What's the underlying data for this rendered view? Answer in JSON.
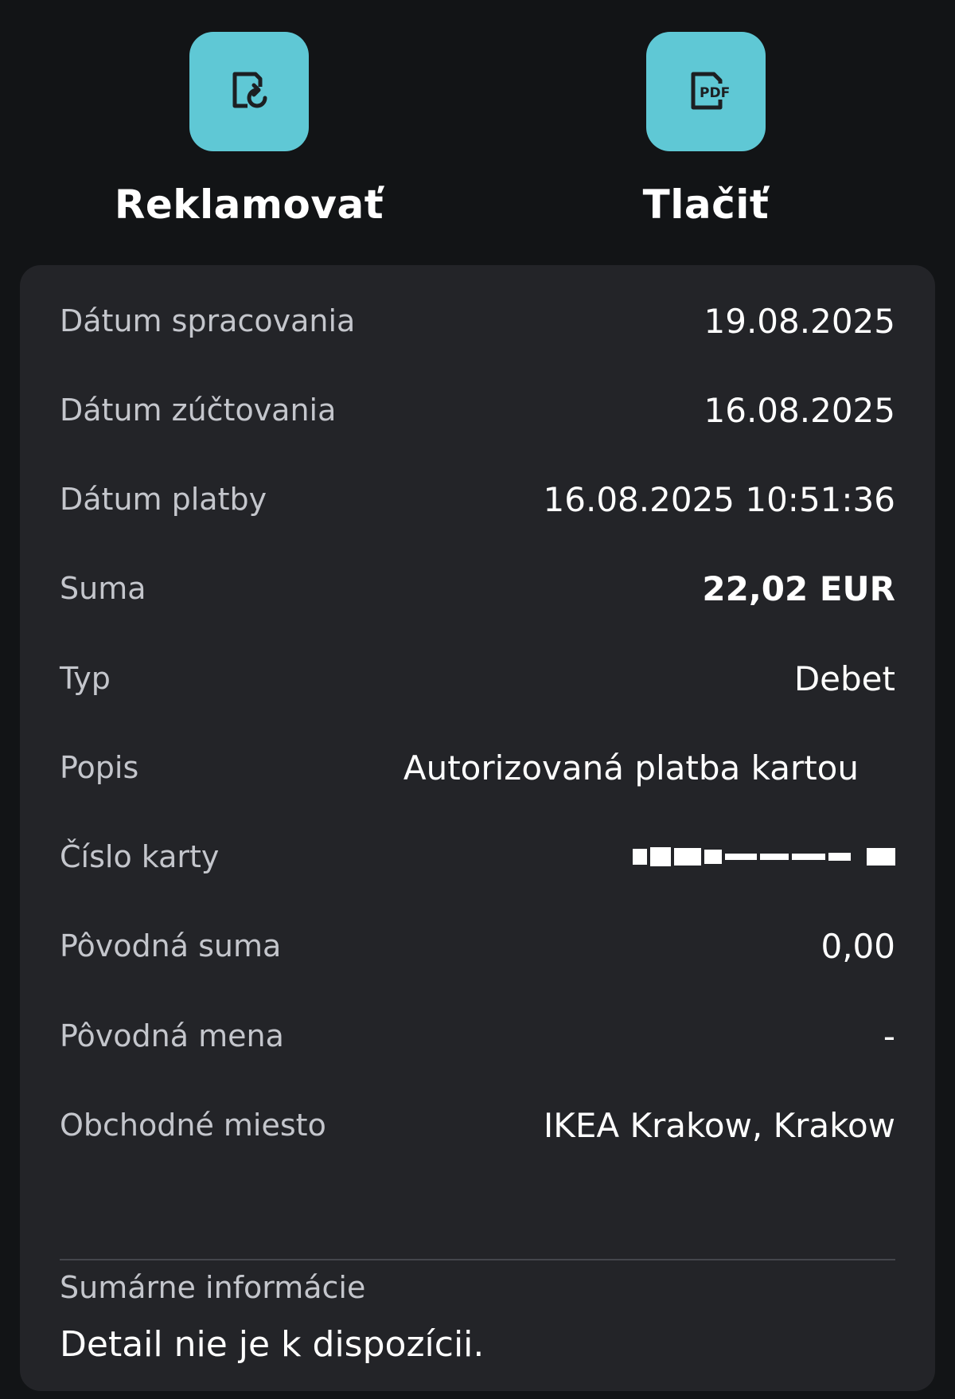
{
  "actions": [
    {
      "label": "Reklamovať",
      "icon": "complaint-icon"
    },
    {
      "label": "Tlačiť",
      "icon": "pdf-icon",
      "icon_text": "PDF"
    }
  ],
  "details": {
    "processing_date": {
      "label": "Dátum spracovania",
      "value": "19.08.2025"
    },
    "settlement_date": {
      "label": "Dátum zúčtovania",
      "value": "16.08.2025"
    },
    "payment_date": {
      "label": "Dátum platby",
      "value": "16.08.2025 10:51:36"
    },
    "amount": {
      "label": "Suma",
      "value": "22,02 EUR"
    },
    "type": {
      "label": "Typ",
      "value": "Debet"
    },
    "description": {
      "label": "Popis",
      "value": "Autorizovaná platba kartou"
    },
    "card_number": {
      "label": "Číslo karty"
    },
    "original_amount": {
      "label": "Pôvodná suma",
      "value": "0,00"
    },
    "original_currency": {
      "label": "Pôvodná mena",
      "value": "-"
    },
    "merchant": {
      "label": "Obchodné miesto",
      "value": "IKEA Krakow, Krakow"
    }
  },
  "summary": {
    "title": "Sumárne informácie",
    "text": "Detail nie je k dispozícii."
  },
  "colors": {
    "background": "#121416",
    "card": "#232428",
    "accent": "#5fc8d5"
  }
}
